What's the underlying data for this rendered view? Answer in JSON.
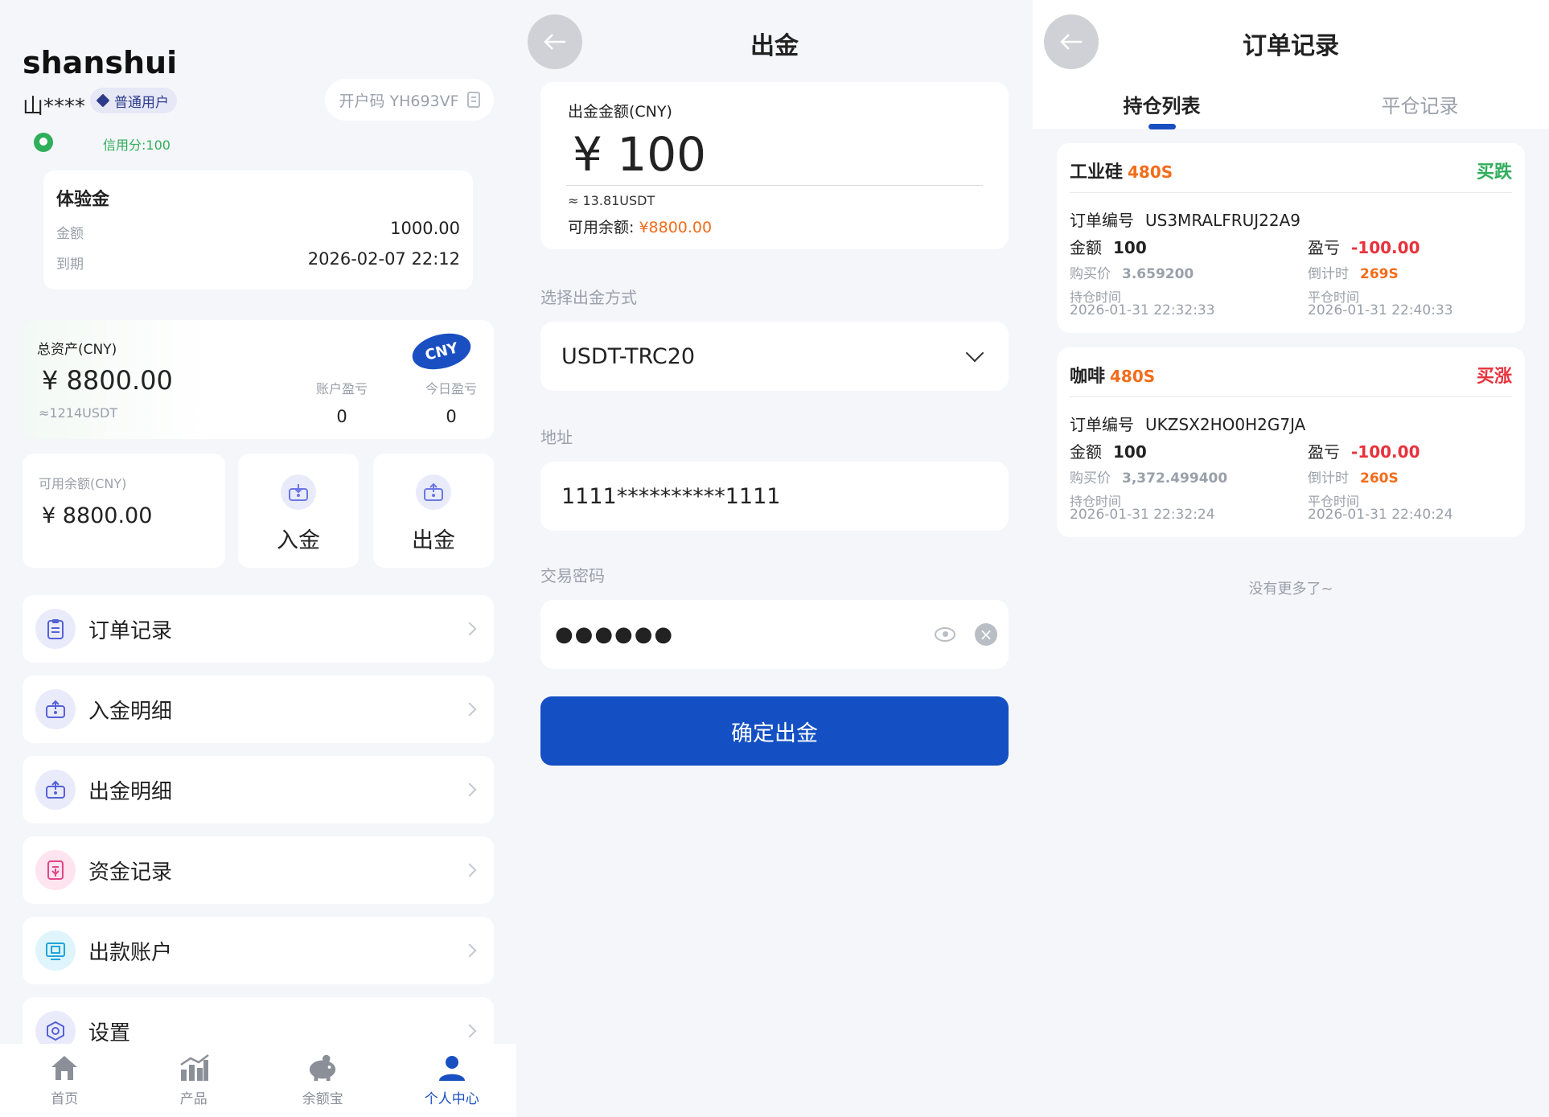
{
  "profile": {
    "username": "shanshui",
    "masked_name": "山****",
    "user_level": "普通用户",
    "invite_code": "开户码 YH693VF",
    "credit": "信用分:100",
    "trial": {
      "title": "体验金",
      "amount_label": "金额",
      "amount": "1000.00",
      "expire_label": "到期",
      "expire": "2026-02-07 22:12"
    },
    "assets": {
      "title": "总资产(CNY)",
      "value": "¥  8800.00",
      "usdt": "≈1214USDT",
      "currency_badge": "CNY",
      "account_pl_label": "账户盈亏",
      "account_pl": "0",
      "today_pl_label": "今日盈亏",
      "today_pl": "0"
    },
    "available": {
      "label": "可用余额(CNY)",
      "value": "¥ 8800.00"
    },
    "actions": {
      "deposit": "入金",
      "withdraw": "出金"
    },
    "menu": [
      {
        "label": "订单记录",
        "icon": "clipboard-icon",
        "color": "#e9ebfb"
      },
      {
        "label": "入金明细",
        "icon": "deposit-icon",
        "color": "#e9ebfb"
      },
      {
        "label": "出金明细",
        "icon": "withdraw-icon",
        "color": "#e9ebfb"
      },
      {
        "label": "资金记录",
        "icon": "funds-record-icon",
        "color": "#fde4ef"
      },
      {
        "label": "出款账户",
        "icon": "bank-account-icon",
        "color": "#dff4fb"
      },
      {
        "label": "设置",
        "icon": "settings-icon",
        "color": "#e9ebfb"
      }
    ],
    "tabbar": [
      {
        "label": "首页",
        "icon": "home-icon"
      },
      {
        "label": "产品",
        "icon": "chart-icon"
      },
      {
        "label": "余额宝",
        "icon": "piggy-bank-icon"
      },
      {
        "label": "个人中心",
        "icon": "user-icon",
        "active": true
      }
    ]
  },
  "withdraw": {
    "title": "出金",
    "amount_label": "出金金额(CNY)",
    "amount": "¥ 100",
    "usdt_equiv": "≈ 13.81USDT",
    "available_label": "可用余额:",
    "available_value": "¥8800.00",
    "method_label": "选择出金方式",
    "method_value": "USDT-TRC20",
    "address_label": "地址",
    "address_value": "1111**********1111",
    "password_label": "交易密码",
    "password_value": "●●●●●●",
    "submit": "确定出金"
  },
  "orders": {
    "title": "订单记录",
    "tabs": [
      "持仓列表",
      "平仓记录"
    ],
    "items": [
      {
        "name": "工业硅",
        "duration": "480S",
        "direction": "买跌",
        "order_no_label": "订单编号",
        "order_no": "US3MRALFRUJ22A9",
        "amount_label": "金额",
        "amount": "100",
        "pl_label": "盈亏",
        "pl": "-100.00",
        "buy_price_label": "购买价",
        "buy_price": "3.659200",
        "countdown_label": "倒计时",
        "countdown": "269S",
        "open_time_label": "持仓时间",
        "open_time": "2026-01-31 22:32:33",
        "close_time_label": "平仓时间",
        "close_time": "2026-01-31 22:40:33"
      },
      {
        "name": "咖啡",
        "duration": "480S",
        "direction": "买涨",
        "order_no_label": "订单编号",
        "order_no": "UKZSX2HO0H2G7JA",
        "amount_label": "金额",
        "amount": "100",
        "pl_label": "盈亏",
        "pl": "-100.00",
        "buy_price_label": "购买价",
        "buy_price": "3,372.499400",
        "countdown_label": "倒计时",
        "countdown": "260S",
        "open_time_label": "持仓时间",
        "open_time": "2026-01-31 22:32:24",
        "close_time_label": "平仓时间",
        "close_time": "2026-01-31 22:40:24"
      }
    ],
    "no_more": "没有更多了~"
  },
  "colors": {
    "brand_blue": "#1450c3",
    "orange": "#f36c1a",
    "green": "#2fae5b",
    "red": "#e8323c"
  }
}
